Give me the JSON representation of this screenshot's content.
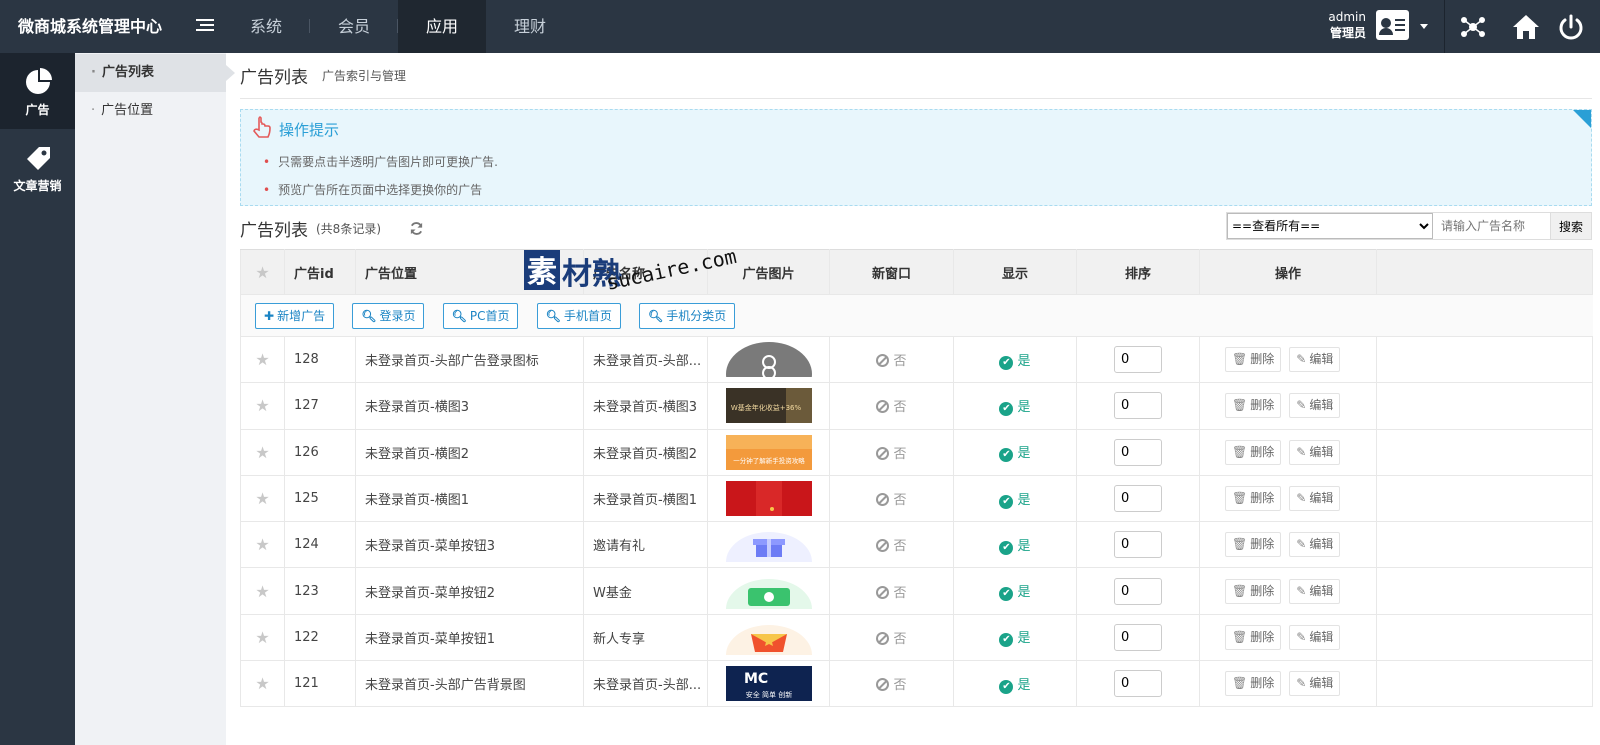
{
  "app": {
    "brand": "微商城系统管理中心",
    "nav": [
      "系统",
      "会员",
      "应用",
      "理财"
    ],
    "user": {
      "name": "admin",
      "role": "管理员"
    }
  },
  "leftbar": [
    {
      "label": "广告",
      "icon": "pie-chart-icon"
    },
    {
      "label": "文章营销",
      "icon": "tag-icon"
    }
  ],
  "subnav": [
    "广告列表",
    "广告位置"
  ],
  "page": {
    "title": "广告列表",
    "subtitle": "广告索引与管理"
  },
  "tips": {
    "title": "操作提示",
    "items": [
      "只需要点击半透明广告图片即可更换广告.",
      "预览广告所在页面中选择更换你的广告"
    ]
  },
  "list": {
    "title": "广告列表",
    "count": "(共8条记录)",
    "filter_value": "==查看所有==",
    "filter_options": [
      "==查看所有=="
    ],
    "search_placeholder": "请输入广告名称",
    "search_label": "搜索"
  },
  "columns": [
    "",
    "广告id",
    "广告位置",
    "广告名称",
    "广告图片",
    "新窗口",
    "显示",
    "排序",
    "操作"
  ],
  "toolbar": {
    "add": "新增广告",
    "filters": [
      "登录页",
      "PC首页",
      "手机首页",
      "手机分类页"
    ]
  },
  "status": {
    "no": "否",
    "yes": "是"
  },
  "actions": {
    "delete": "删除",
    "edit": "编辑"
  },
  "rows": [
    {
      "id": "128",
      "position": "未登录首页-头部广告登录图标",
      "name": "未登录首页-头部...",
      "sort": "0",
      "thumb": "avatar"
    },
    {
      "id": "127",
      "position": "未登录首页-横图3",
      "name": "未登录首页-横图3",
      "sort": "0",
      "thumb": "banner3",
      "thumb_text": "W基金年化收益+36%"
    },
    {
      "id": "126",
      "position": "未登录首页-横图2",
      "name": "未登录首页-横图2",
      "sort": "0",
      "thumb": "banner2",
      "thumb_text": "一分钟了解新手投资攻略"
    },
    {
      "id": "125",
      "position": "未登录首页-横图1",
      "name": "未登录首页-横图1",
      "sort": "0",
      "thumb": "banner1"
    },
    {
      "id": "124",
      "position": "未登录首页-菜单按钮3",
      "name": "邀请有礼",
      "sort": "0",
      "thumb": "gift"
    },
    {
      "id": "123",
      "position": "未登录首页-菜单按钮2",
      "name": "W基金",
      "sort": "0",
      "thumb": "fund"
    },
    {
      "id": "122",
      "position": "未登录首页-菜单按钮1",
      "name": "新人专享",
      "sort": "0",
      "thumb": "envelope"
    },
    {
      "id": "121",
      "position": "未登录首页-头部广告背景图",
      "name": "未登录首页-头部...",
      "sort": "0",
      "thumb": "dark",
      "thumb_text": "安全 简单 创新"
    }
  ],
  "watermark": {
    "text1": "素材熟",
    "text2": "sucaire.com"
  }
}
